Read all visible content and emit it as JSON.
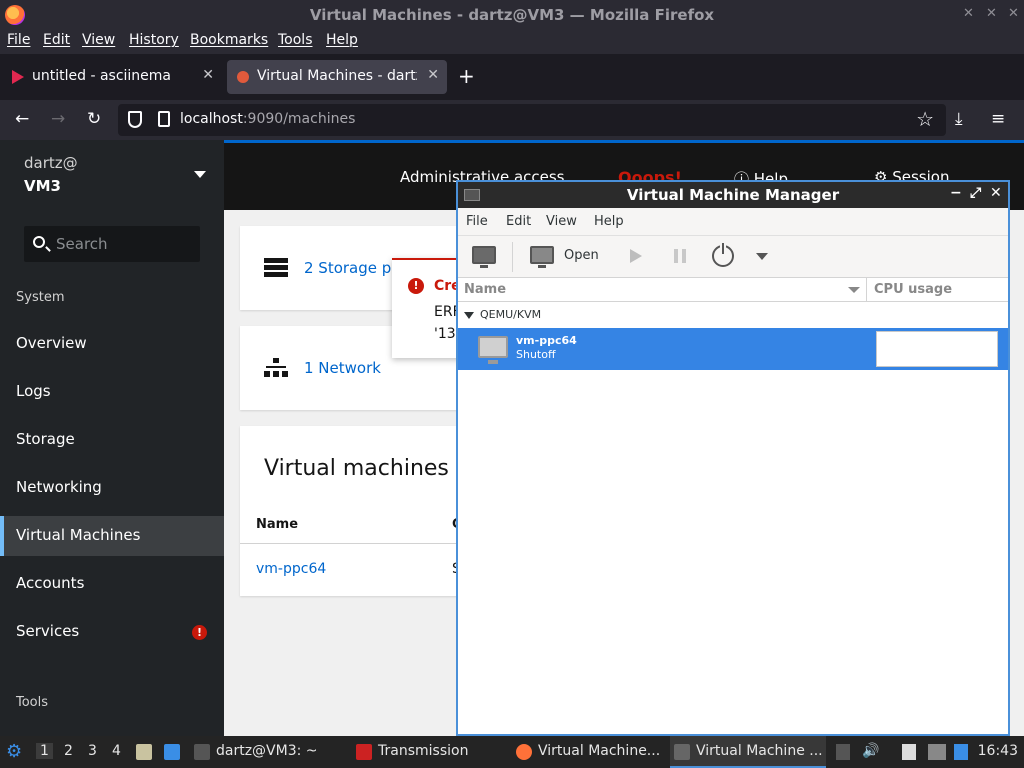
{
  "firefox": {
    "window_title": "Virtual Machines - dartz@VM3 — Mozilla Firefox",
    "menu": [
      "File",
      "Edit",
      "View",
      "History",
      "Bookmarks",
      "Tools",
      "Help"
    ],
    "tabs": [
      {
        "label": "untitled - asciinema",
        "icon": "asciinema-icon"
      },
      {
        "label": "Virtual Machines - dartz@",
        "icon": "cockpit-icon"
      }
    ],
    "url_host": "localhost",
    "url_rest": ":9090/machines"
  },
  "cockpit": {
    "host_user": "dartz@",
    "host_name": "VM3",
    "search_placeholder": "Search",
    "section_system": "System",
    "nav": [
      "Overview",
      "Logs",
      "Storage",
      "Networking",
      "Virtual Machines",
      "Accounts",
      "Services"
    ],
    "active_nav": "Virtual Machines",
    "section_tools": "Tools",
    "services_badge": "!",
    "topbar": {
      "admin": "Administrative access",
      "oops": "Ooops!",
      "help": "Help",
      "session": "Session"
    },
    "storage_link": "2 Storage po",
    "network_link": "1 Network",
    "vm_card": {
      "title": "Virtual machines",
      "col_name": "Name",
      "col_second": "C",
      "rows": [
        {
          "name": "vm-ppc64",
          "second": "S"
        }
      ]
    },
    "alert": {
      "icon": "!",
      "title": "Cre",
      "line1": "ERF",
      "line2": "'137"
    }
  },
  "vmm": {
    "title": "Virtual Machine Manager",
    "menu": [
      "File",
      "Edit",
      "View",
      "Help"
    ],
    "toolbar_open": "Open",
    "col_name": "Name",
    "col_cpu": "CPU usage",
    "group": "QEMU/KVM",
    "vm": {
      "name": "vm-ppc64",
      "state": "Shutoff"
    }
  },
  "taskbar": {
    "workspaces": [
      "1",
      "2",
      "3",
      "4"
    ],
    "tasks": [
      {
        "label": "dartz@VM3: ~"
      },
      {
        "label": "Transmission"
      },
      {
        "label": "Virtual Machine..."
      },
      {
        "label": "Virtual Machine ..."
      }
    ],
    "clock": "16:43"
  }
}
